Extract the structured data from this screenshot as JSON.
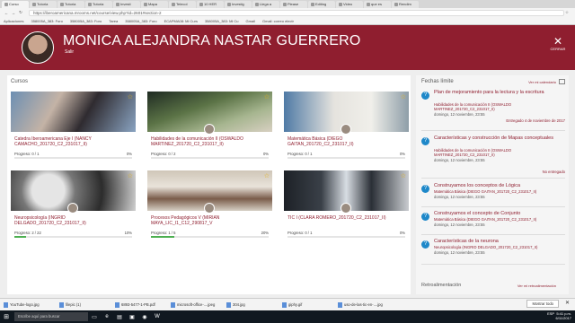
{
  "browser": {
    "tabs": [
      "Curso",
      "Tutoria",
      "Tutoria",
      "Tutoria",
      "Investi",
      "Mapa",
      "Telecol",
      "10 HER",
      "Investig",
      "Llega a",
      "Please",
      "Editing",
      "Video",
      "que es",
      "Rendim"
    ],
    "url": "https://iberoamericana.mrooms.net/course/view.php?id=2601#section-2",
    "bookmarks": [
      "Aplicaciones",
      "358005A_383: Foro",
      "358005A_383: Foro",
      "Tarea",
      "358005A_383: Foro",
      "ECAPMA08: Mi Curs",
      "358005A_383: Mi Cu",
      "Gmail",
      "Gmail: correo electr"
    ]
  },
  "header": {
    "user_name": "MONICA ALEJANDRA NASTAR GUERRERO",
    "logout": "Salir",
    "close_label": "CERRAR",
    "brand_color": "#8f1e2f"
  },
  "courses": {
    "heading": "Cursos",
    "items": [
      {
        "title": "Catedra Iberoamericana Eje I (NANCY CAMACHO_201720_C2_231017_II)",
        "progress": "Progreso: 0 / 1",
        "pct": "0%",
        "fraction": 0
      },
      {
        "title": "Habilidades de la comunicación II (OSWALDO MARTINEZ_201720_C2_231017_II)",
        "progress": "Progreso: 0 / 2",
        "pct": "0%",
        "fraction": 0
      },
      {
        "title": "Matemática Básica (DIEGO GAITAN_201720_C2_231017_II)",
        "progress": "Progreso: 0 / 1",
        "pct": "0%",
        "fraction": 0
      },
      {
        "title": "Neuropsicología (INGRID DELGADO_201720_C2_231017_II)",
        "progress": "Progreso: 2 / 22",
        "pct": "10%",
        "fraction": 0.1
      },
      {
        "title": "Procesos Pedagógicos V (MIRIAN MAYA_LIC_I1_C12_290817_V",
        "progress": "Progreso: 1 / 5",
        "pct": "20%",
        "fraction": 0.2
      },
      {
        "title": "TIC I (CLARA ROMERO_201720_C2_231017_II)",
        "progress": "Progreso: 0 / 1",
        "pct": "0%",
        "fraction": 0
      }
    ]
  },
  "deadlines": {
    "heading": "Fechas límite",
    "view_calendar": "Ver mi calendario",
    "items": [
      {
        "title": "Plan de mejoramiento para la lectura y la escritura",
        "course": "Habilidades de la comunicación II (OSWALDO MARTINEZ_201720_C2_231017_II)",
        "date": "domingo, 12 noviembre, 23:55",
        "status": "Entregado 4 de noviembre de 2017"
      },
      {
        "title": "Características y construcción de Mapas conceptuales",
        "course": "Habilidades de la comunicación II (OSWALDO MARTINEZ_201720_C2_231017_II)",
        "date": "domingo, 12 noviembre, 23:55",
        "status": "No entregado"
      },
      {
        "title": "Construyamos los conceptos de Lógica",
        "course": "Matemática Básica (DIEGO GAITAN_201720_C2_231017_II)",
        "date": "domingo, 12 noviembre, 23:55",
        "status": ""
      },
      {
        "title": "Construyamos el concepto de Conjunto",
        "course": "Matemática Básica (DIEGO GAITAN_201720_C2_231017_II)",
        "date": "domingo, 12 noviembre, 23:55",
        "status": ""
      },
      {
        "title": "Características de la neurona",
        "course": "Neuropsicología (INGRID DELGADO_201720_C2_231017_II)",
        "date": "domingo, 12 noviembre, 23:55",
        "status": ""
      }
    ]
  },
  "feedback": {
    "heading": "Retroalimentación",
    "link": "Ver mi retroalimentación"
  },
  "downloads": {
    "items": [
      "YouTube-logo.jpg",
      "filepic (1)",
      "6893-5477-1-PB.pdf",
      "microsoft-office-....jpeg",
      "304.jpg",
      "giphy.gif",
      "uso-de-las-tic-en-....jpg"
    ],
    "show_all": "Mostrar todo"
  },
  "taskbar": {
    "search_placeholder": "Escribe aquí para buscar",
    "lang": "ESP",
    "time": "5:41 p.m.",
    "date": "6/11/2017"
  }
}
